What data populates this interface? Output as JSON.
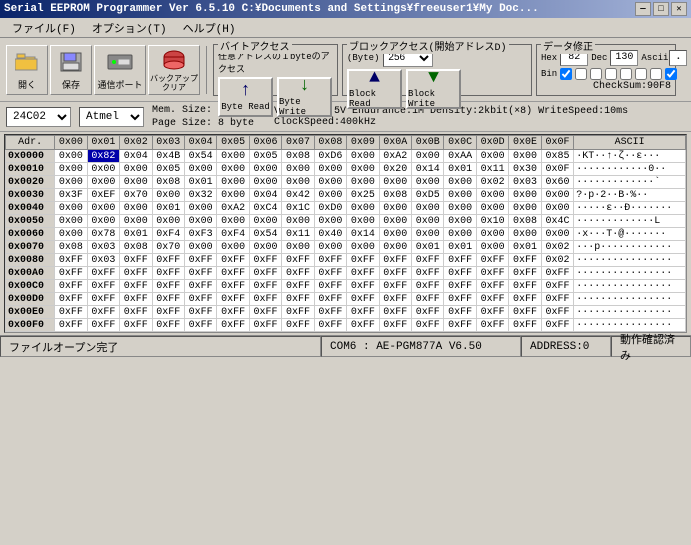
{
  "titleBar": {
    "title": "Serial EEPROM Programmer Ver 6.5.10  C:¥Documents and Settings¥freeuser1¥My Doc...",
    "minBtn": "—",
    "maxBtn": "□",
    "closeBtn": "✕"
  },
  "menuBar": {
    "items": [
      "ファイル(F)",
      "オプション(T)",
      "ヘルプ(H)"
    ]
  },
  "toolbar": {
    "openLabel": "開く",
    "saveLabel": "保存",
    "comPortLabel": "通信ポート",
    "backupClearLabel": "バックアップクリア"
  },
  "byteAccess": {
    "title": "バイトアクセス",
    "subtitle": "任意アドレスの１byteのアクセス",
    "byteReadLabel": "Byte Read",
    "byteWriteLabel": "Byte Write"
  },
  "blockAccess": {
    "title": "ブロックアクセス(開始アドレスD)",
    "subtitle": "(Byte)",
    "value": "256",
    "blockReadLabel": "Block Read",
    "blockWriteLabel": "Block Write"
  },
  "dataEdit": {
    "title": "データ修正",
    "hexLabel": "Hex",
    "decLabel": "Dec",
    "asciiLabel": "Ascii",
    "hexValue": "82",
    "decValue": "130",
    "asciiValue": "･",
    "binLabel": "Bin",
    "binValue": "",
    "checksumLabel": "CheckSum:90F8"
  },
  "deviceInfo": {
    "deviceCode": "24C02",
    "manufacturer": "Atmel",
    "memSize": "Mem. Size: 256 byte",
    "pageSize": "Page Size: 8 byte"
  },
  "vddInfo": "VDD:1.8-5.5V  Endurance:1M Density:2kbit(×8) WriteSpeed:10ms ClockSpeed:400kHz",
  "tableHeaders": [
    "Adr.",
    "0x00",
    "0x01",
    "0x02",
    "0x03",
    "0x04",
    "0x05",
    "0x06",
    "0x07",
    "0x08",
    "0x09",
    "0x0A",
    "0x0B",
    "0x0C",
    "0x0D",
    "0x0E",
    "0x0F",
    "ASCII"
  ],
  "tableData": [
    {
      "addr": "0x0000",
      "cells": [
        "0x00",
        "0x82",
        "0x04",
        "0x4B",
        "0x54",
        "0x00",
        "0x05",
        "0x08",
        "0xD6",
        "0x00",
        "0xA2",
        "0x00",
        "0xAA",
        "0x00",
        "0x00",
        "0x85"
      ],
      "ascii": "·KT··↑·ζ··ε···",
      "selectedCell": 1
    },
    {
      "addr": "0x0010",
      "cells": [
        "0x00",
        "0x00",
        "0x00",
        "0x05",
        "0x00",
        "0x00",
        "0x00",
        "0x00",
        "0x00",
        "0x00",
        "0x20",
        "0x14",
        "0x01",
        "0x11",
        "0x30",
        "0x0F"
      ],
      "ascii": "············0··"
    },
    {
      "addr": "0x0020",
      "cells": [
        "0x00",
        "0x00",
        "0x00",
        "0x08",
        "0x01",
        "0x00",
        "0x00",
        "0x00",
        "0x00",
        "0x00",
        "0x00",
        "0x00",
        "0x00",
        "0x02",
        "0x03",
        "0x60"
      ],
      "ascii": "·············`"
    },
    {
      "addr": "0x0030",
      "cells": [
        "0x3F",
        "0xEF",
        "0x70",
        "0x00",
        "0x32",
        "0x00",
        "0x04",
        "0x42",
        "0x00",
        "0x25",
        "0x08",
        "0xD5",
        "0x00",
        "0x00",
        "0x00",
        "0x00"
      ],
      "ascii": "?·p·2··B·%··"
    },
    {
      "addr": "0x0040",
      "cells": [
        "0x00",
        "0x00",
        "0x00",
        "0x01",
        "0x00",
        "0xA2",
        "0xC4",
        "0x1C",
        "0xD0",
        "0x00",
        "0x00",
        "0x00",
        "0x00",
        "0x00",
        "0x00",
        "0x00"
      ],
      "ascii": "·····ε··Ð·······"
    },
    {
      "addr": "0x0050",
      "cells": [
        "0x00",
        "0x00",
        "0x00",
        "0x00",
        "0x00",
        "0x00",
        "0x00",
        "0x00",
        "0x00",
        "0x00",
        "0x00",
        "0x00",
        "0x00",
        "0x10",
        "0x08",
        "0x4C"
      ],
      "ascii": "·············L"
    },
    {
      "addr": "0x0060",
      "cells": [
        "0x00",
        "0x78",
        "0x01",
        "0xF4",
        "0xF3",
        "0xF4",
        "0x54",
        "0x11",
        "0x40",
        "0x14",
        "0x00",
        "0x00",
        "0x00",
        "0x00",
        "0x00",
        "0x00"
      ],
      "ascii": "·x···T·@·······"
    },
    {
      "addr": "0x0070",
      "cells": [
        "0x08",
        "0x03",
        "0x08",
        "0x70",
        "0x00",
        "0x00",
        "0x00",
        "0x00",
        "0x00",
        "0x00",
        "0x00",
        "0x01",
        "0x01",
        "0x00",
        "0x01",
        "0x02"
      ],
      "ascii": "···p············"
    },
    {
      "addr": "0x0080",
      "cells": [
        "0xFF",
        "0x03",
        "0xFF",
        "0xFF",
        "0xFF",
        "0xFF",
        "0xFF",
        "0xFF",
        "0xFF",
        "0xFF",
        "0xFF",
        "0xFF",
        "0xFF",
        "0xFF",
        "0xFF",
        "0x02"
      ],
      "ascii": "················"
    },
    {
      "addr": "0x00A0",
      "cells": [
        "0xFF",
        "0xFF",
        "0xFF",
        "0xFF",
        "0xFF",
        "0xFF",
        "0xFF",
        "0xFF",
        "0xFF",
        "0xFF",
        "0xFF",
        "0xFF",
        "0xFF",
        "0xFF",
        "0xFF",
        "0xFF"
      ],
      "ascii": "················"
    },
    {
      "addr": "0x00C0",
      "cells": [
        "0xFF",
        "0xFF",
        "0xFF",
        "0xFF",
        "0xFF",
        "0xFF",
        "0xFF",
        "0xFF",
        "0xFF",
        "0xFF",
        "0xFF",
        "0xFF",
        "0xFF",
        "0xFF",
        "0xFF",
        "0xFF"
      ],
      "ascii": "················"
    },
    {
      "addr": "0x00D0",
      "cells": [
        "0xFF",
        "0xFF",
        "0xFF",
        "0xFF",
        "0xFF",
        "0xFF",
        "0xFF",
        "0xFF",
        "0xFF",
        "0xFF",
        "0xFF",
        "0xFF",
        "0xFF",
        "0xFF",
        "0xFF",
        "0xFF"
      ],
      "ascii": "················"
    },
    {
      "addr": "0x00E0",
      "cells": [
        "0xFF",
        "0xFF",
        "0xFF",
        "0xFF",
        "0xFF",
        "0xFF",
        "0xFF",
        "0xFF",
        "0xFF",
        "0xFF",
        "0xFF",
        "0xFF",
        "0xFF",
        "0xFF",
        "0xFF",
        "0xFF"
      ],
      "ascii": "················"
    },
    {
      "addr": "0x00F0",
      "cells": [
        "0xFF",
        "0xFF",
        "0xFF",
        "0xFF",
        "0xFF",
        "0xFF",
        "0xFF",
        "0xFF",
        "0xFF",
        "0xFF",
        "0xFF",
        "0xFF",
        "0xFF",
        "0xFF",
        "0xFF",
        "0xFF"
      ],
      "ascii": "················"
    }
  ],
  "statusBar": {
    "leftText": "ファイルオープン完了",
    "centerText": "COM6 : AE-PGM877A V6.50",
    "rightText": "ADDRESS:0",
    "actionText": "動作確認済み"
  }
}
